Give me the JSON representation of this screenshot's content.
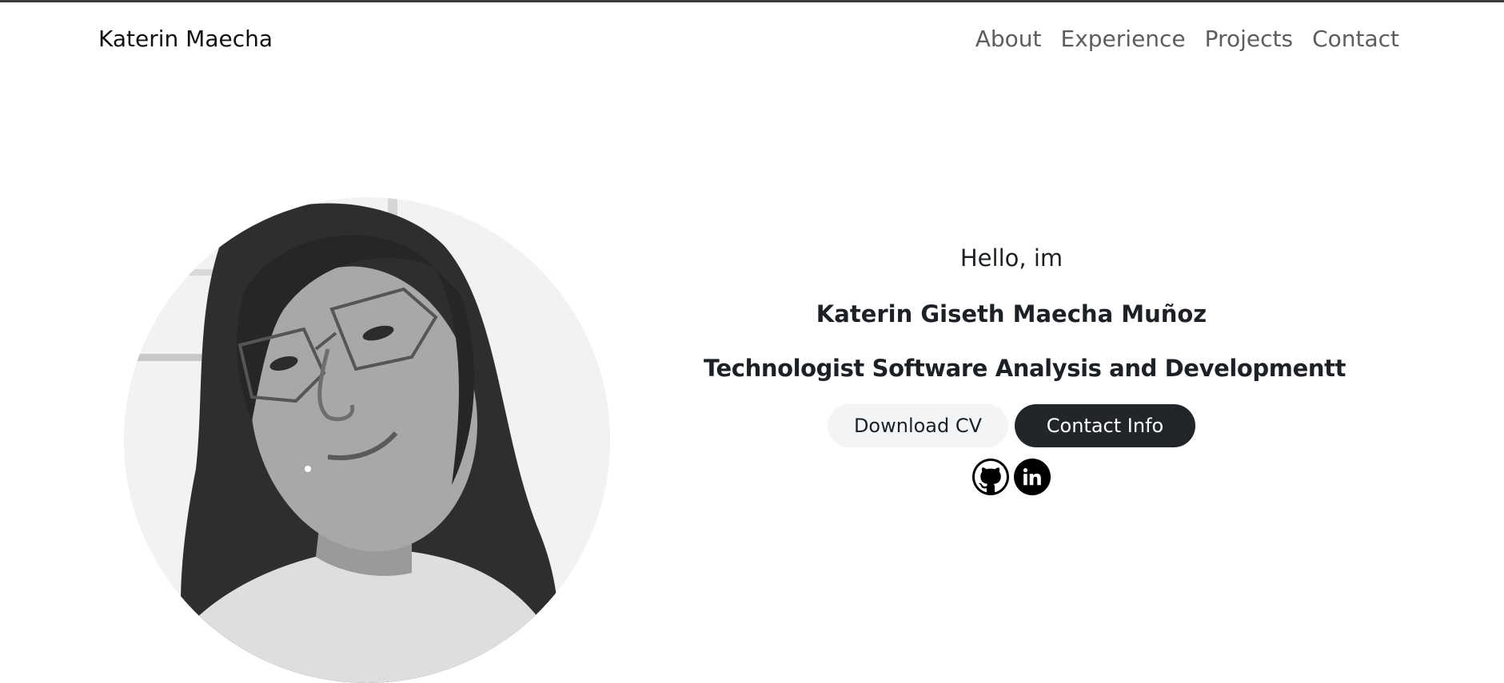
{
  "nav": {
    "brand": "Katerin Maecha",
    "links": [
      "About",
      "Experience",
      "Projects",
      "Contact"
    ]
  },
  "hero": {
    "greeting": "Hello, im",
    "name": "Katerin Giseth Maecha Muñoz",
    "title": "Technologist Software Analysis and Developmentt",
    "buttons": {
      "download": "Download CV",
      "contact": "Contact Info"
    },
    "socials": [
      "github-icon",
      "linkedin-icon"
    ]
  },
  "colors": {
    "text": "#1d2126",
    "nav_link": "#5d5d5d",
    "button_dark": "#22262b",
    "button_light": "#f3f4f6",
    "top_border": "#3c3c3c"
  }
}
